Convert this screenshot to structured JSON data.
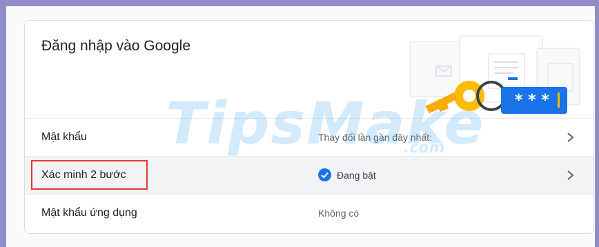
{
  "card": {
    "title": "Đăng nhập vào Google"
  },
  "rows": [
    {
      "label": "Mật khẩu",
      "value": "Thay đổi lần gần đây nhất:"
    },
    {
      "label": "Xác minh 2 bước",
      "value": "Đang bật"
    },
    {
      "label": "Mật khẩu ứng dụng",
      "value": "Không có"
    }
  ],
  "illustration": {
    "password_mask": "* * *"
  },
  "watermark": {
    "brand": "TipsMake",
    "suffix": ".com"
  },
  "icons": {
    "chevron": "chevron-right-icon",
    "status": "check-circle-icon",
    "illustration": "key-and-password-illustration-icon"
  },
  "colors": {
    "frame": "#8f8cc8",
    "accent": "#1a73e8",
    "highlight": "#e53935",
    "key": "#fbbc04"
  }
}
